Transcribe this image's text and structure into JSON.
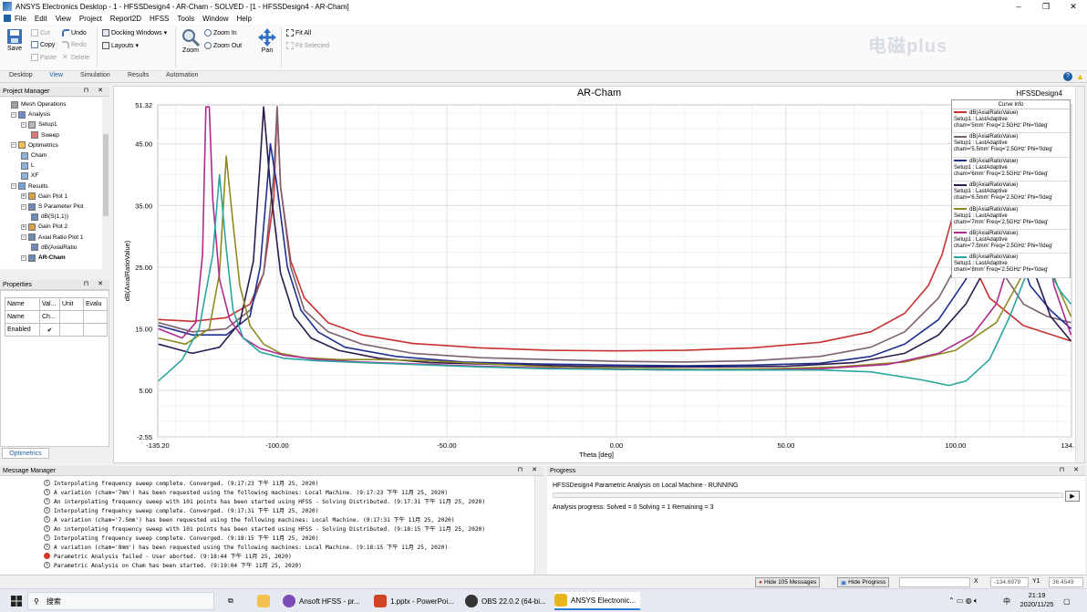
{
  "window": {
    "title": "ANSYS Electronics Desktop - 1 - HFSSDesign4 - AR-Cham - SOLVED - [1 - HFSSDesign4 - AR-Cham]",
    "controls": [
      "–",
      "❐",
      "✕"
    ]
  },
  "menu": [
    "File",
    "Edit",
    "View",
    "Project",
    "Report2D",
    "HFSS",
    "Tools",
    "Window",
    "Help"
  ],
  "ribbon": {
    "save": "Save",
    "cut": "Cut",
    "copy": "Copy",
    "paste": "Paste",
    "undo": "Undo",
    "redo": "Redo",
    "delete": "Delete",
    "docking_windows": "Docking Windows ▾",
    "layouts": "Layouts ▾",
    "zoom": "Zoom",
    "zoom_in": "Zoom In",
    "zoom_out": "Zoom Out",
    "pan": "Pan",
    "fit_all": "Fit All",
    "fit_selected": "Fit Selected",
    "watermark": "电磁plus",
    "tabs": [
      "Desktop",
      "View",
      "Simulation",
      "Results",
      "Automation"
    ],
    "active_tab": "View"
  },
  "project_manager": {
    "title": "Project Manager",
    "tree": [
      {
        "label": "Mesh Operations",
        "level": 2
      },
      {
        "label": "Analysis",
        "level": 2
      },
      {
        "label": "Setup1",
        "level": 3
      },
      {
        "label": "Sweep",
        "level": 4
      },
      {
        "label": "Optimetrics",
        "level": 2
      },
      {
        "label": "Cham",
        "level": 3
      },
      {
        "label": "L",
        "level": 3
      },
      {
        "label": "XF",
        "level": 3
      },
      {
        "label": "Results",
        "level": 2
      },
      {
        "label": "Gain Plot 1",
        "level": 3
      },
      {
        "label": "S Parameter Plot",
        "level": 3
      },
      {
        "label": "dB(S(1,1))",
        "level": 4
      },
      {
        "label": "Gain Plot 2",
        "level": 3
      },
      {
        "label": "Axial Ratio Plot 1",
        "level": 3
      },
      {
        "label": "dB(AxialRatio",
        "level": 4
      },
      {
        "label": "AR-Cham",
        "level": 3
      }
    ]
  },
  "properties": {
    "title": "Properties",
    "headers": [
      "Name",
      "Val...",
      "Unit",
      "Evalu"
    ],
    "rows": [
      [
        "Name",
        "Ch...",
        "",
        ""
      ],
      [
        "Enabled",
        "✔",
        "",
        ""
      ]
    ],
    "tab": "Optimetrics"
  },
  "plot": {
    "title": "AR-Cham",
    "design": "HFSSDesign4",
    "legend_title": "Curve Info",
    "legend": [
      {
        "l1": "dB(AxialRatioValue)",
        "l2": "Setup1 : LastAdaptive",
        "l3": "cham='5mm' Freq='2.5GHz' Phi='0deg'",
        "color": "#c8312f"
      },
      {
        "l1": "dB(AxialRatioValue)",
        "l2": "Setup1 : LastAdaptive",
        "l3": "cham='5.5mm' Freq='2.5GHz' Phi='0deg'",
        "color": "#7c6170"
      },
      {
        "l1": "dB(AxialRatioValue)",
        "l2": "Setup1 : LastAdaptive",
        "l3": "cham='6mm' Freq='2.5GHz' Phi='0deg'",
        "color": "#1f2f8f"
      },
      {
        "l1": "dB(AxialRatioValue)",
        "l2": "Setup1 : LastAdaptive",
        "l3": "cham='6.5mm' Freq='2.5GHz' Phi='0deg'",
        "color": "#2c1a4d"
      },
      {
        "l1": "dB(AxialRatioValue)",
        "l2": "Setup1 : LastAdaptive",
        "l3": "cham='7mm' Freq='2.5GHz' Phi='0deg'",
        "color": "#8e8a22"
      },
      {
        "l1": "dB(AxialRatioValue)",
        "l2": "Setup1 : LastAdaptive",
        "l3": "cham='7.5mm' Freq='2.5GHz' Phi='0deg'",
        "color": "#b02a8e"
      },
      {
        "l1": "dB(AxialRatioValue)",
        "l2": "Setup1 : LastAdaptive",
        "l3": "cham='8mm' Freq='2.5GHz' Phi='0deg'",
        "color": "#2aa6a0"
      }
    ]
  },
  "chart_data": {
    "type": "line",
    "title": "AR-Cham",
    "xlabel": "Theta [deg]",
    "ylabel": "dB(AxialRatioValue)",
    "xlim": [
      -135.2,
      134.17
    ],
    "ylim": [
      -2.55,
      51.32
    ],
    "xticks": [
      -135.2,
      -100.0,
      -50.0,
      0.0,
      50.0,
      100.0,
      134.17
    ],
    "xtick_labels": [
      "-135.20",
      "-100.00",
      "-50.00",
      "0.00",
      "50.00",
      "100.00",
      "134.17"
    ],
    "yticks": [
      -2.55,
      5.0,
      15.0,
      25.0,
      35.0,
      45.0,
      51.32
    ],
    "ytick_labels": [
      "-2.55",
      "5.00",
      "15.00",
      "25.00",
      "35.00",
      "45.00",
      "51.32"
    ],
    "grid": true,
    "legend_position": "top-right",
    "series": [
      {
        "name": "cham='5mm'",
        "color": "#c8312f",
        "x": [
          -135,
          -125,
          -115,
          -108,
          -104,
          -101,
          -100,
          -99,
          -96,
          -92,
          -85,
          -75,
          -60,
          -40,
          -20,
          0,
          20,
          40,
          60,
          75,
          85,
          92,
          96,
          99,
          101,
          104,
          110,
          120,
          134
        ],
        "y": [
          16.5,
          16.2,
          16.8,
          19,
          24,
          36,
          51,
          38,
          26,
          20,
          16,
          14,
          12.6,
          11.9,
          11.5,
          11.4,
          11.5,
          11.9,
          12.8,
          14.5,
          17.5,
          22,
          27,
          33,
          35,
          27,
          20,
          15.5,
          13
        ]
      },
      {
        "name": "cham='5.5mm'",
        "color": "#7c6170",
        "x": [
          -135,
          -125,
          -115,
          -108,
          -104,
          -101,
          -100,
          -99,
          -96,
          -92,
          -85,
          -75,
          -60,
          -40,
          -20,
          0,
          20,
          40,
          60,
          75,
          85,
          95,
          103,
          107,
          110,
          114,
          120,
          127,
          134
        ],
        "y": [
          16,
          14.5,
          15,
          18,
          24,
          40,
          51,
          38,
          25,
          18,
          14.5,
          12.5,
          11,
          10.3,
          10,
          9.7,
          9.6,
          9.8,
          10.5,
          12,
          14.5,
          20,
          28,
          34,
          32,
          24,
          19,
          17,
          16
        ]
      },
      {
        "name": "cham='6mm'",
        "color": "#1f2f8f",
        "x": [
          -135,
          -125,
          -115,
          -108,
          -105,
          -103,
          -102,
          -100,
          -97,
          -93,
          -88,
          -80,
          -65,
          -45,
          -25,
          0,
          20,
          40,
          60,
          75,
          85,
          95,
          103,
          108,
          113,
          117,
          122,
          128,
          134
        ],
        "y": [
          15.5,
          14,
          14,
          17,
          25,
          38,
          45,
          38,
          25,
          18,
          14.5,
          12,
          10.5,
          9.6,
          9.3,
          9.1,
          9,
          9.1,
          9.4,
          10.5,
          12.5,
          16.5,
          23,
          30,
          35,
          30,
          22,
          18,
          15
        ]
      },
      {
        "name": "cham='6.5mm'",
        "color": "#2c1a4d",
        "x": [
          -135,
          -125,
          -117,
          -111,
          -107,
          -105,
          -104,
          -102,
          -99,
          -95,
          -90,
          -82,
          -70,
          -55,
          -35,
          -10,
          10,
          30,
          50,
          70,
          85,
          95,
          103,
          108,
          113,
          117,
          121,
          124,
          128,
          134
        ],
        "y": [
          12.5,
          11,
          12,
          16,
          26,
          42,
          51,
          38,
          24,
          17,
          13.5,
          11.5,
          10.2,
          9.5,
          9.2,
          8.9,
          8.8,
          8.8,
          8.9,
          9.5,
          11,
          14,
          19,
          24,
          30,
          35,
          30,
          23,
          17,
          13
        ]
      },
      {
        "name": "cham='7mm'",
        "color": "#8e8a22",
        "x": [
          -135,
          -127,
          -120,
          -117,
          -115,
          -113,
          -111,
          -108,
          -104,
          -99,
          -92,
          -82,
          -70,
          -55,
          -35,
          -15,
          5,
          25,
          45,
          65,
          85,
          100,
          112,
          120,
          125,
          130,
          134
        ],
        "y": [
          13.5,
          12.5,
          15,
          24,
          43,
          32,
          22,
          15.5,
          12.5,
          11,
          10.3,
          10,
          10,
          9.8,
          9.2,
          8.7,
          8.5,
          8.4,
          8.5,
          8.8,
          9.6,
          11.5,
          16,
          24,
          30,
          22,
          17
        ]
      },
      {
        "name": "cham='7.5mm'",
        "color": "#b02a8e",
        "x": [
          -135,
          -128,
          -124,
          -122,
          -121,
          -120,
          -119,
          -117,
          -114,
          -110,
          -105,
          -98,
          -88,
          -75,
          -60,
          -40,
          -20,
          0,
          20,
          40,
          60,
          80,
          95,
          105,
          112,
          117,
          120,
          122,
          125,
          129,
          134
        ],
        "y": [
          15,
          13.5,
          16,
          27,
          51,
          51,
          36,
          23,
          16.5,
          13.5,
          11.8,
          10.7,
          10,
          9.6,
          9.3,
          8.9,
          8.6,
          8.4,
          8.3,
          8.3,
          8.5,
          9.2,
          11,
          14,
          19,
          28,
          40,
          51,
          36,
          22,
          14
        ]
      },
      {
        "name": "cham='8mm'",
        "color": "#2aa6a0",
        "x": [
          -135,
          -128,
          -123,
          -119,
          -117,
          -115,
          -113,
          -110,
          -105,
          -98,
          -88,
          -75,
          -60,
          -40,
          -20,
          0,
          20,
          40,
          60,
          75,
          90,
          98,
          103,
          110,
          116,
          121,
          125,
          128,
          131,
          134
        ],
        "y": [
          6.5,
          10,
          15,
          27,
          40,
          28,
          18,
          13.5,
          11.2,
          10.2,
          9.8,
          9.5,
          9.2,
          8.8,
          8.5,
          8.4,
          8.3,
          8.3,
          8.3,
          8,
          6.7,
          5.8,
          6.5,
          10,
          17,
          24,
          27,
          24,
          21,
          19
        ]
      }
    ]
  },
  "messages": {
    "title": "Message Manager",
    "items": [
      {
        "type": "info",
        "text": "Interpolating frequency sweep complete. Converged. (9:17:23 下午  11月 25, 2020)"
      },
      {
        "type": "info",
        "text": "A variation (cham='7mm') has been requested using the following machines: Local Machine. (9:17:23 下午  11月 25, 2020)"
      },
      {
        "type": "info",
        "text": "An interpolating frequency sweep with 101 points has been started using HFSS - Solving Distributed. (9:17:31 下午  11月 25, 2020)"
      },
      {
        "type": "info",
        "text": "Interpolating frequency sweep complete. Converged. (9:17:31 下午  11月 25, 2020)"
      },
      {
        "type": "info",
        "text": "A variation (cham='7.5mm') has been requested using the following machines: Local Machine. (9:17:31 下午  11月 25, 2020)"
      },
      {
        "type": "info",
        "text": "An interpolating frequency sweep with 101 points has been started using HFSS - Solving Distributed. (9:18:15 下午  11月 25, 2020)"
      },
      {
        "type": "info",
        "text": "Interpolating frequency sweep complete. Converged. (9:18:15 下午  11月 25, 2020)"
      },
      {
        "type": "info",
        "text": "A variation (cham='8mm') has been requested using the following machines: Local Machine. (9:18:15 下午  11月 25, 2020)"
      },
      {
        "type": "error",
        "text": "Parametric Analysis failed - User aborted. (9:18:44 下午  11月 25, 2020)"
      },
      {
        "type": "info",
        "text": "Parametric Analysis on Cham has been started. (9:19:04 下午  11月 25, 2020)"
      }
    ]
  },
  "progress": {
    "title": "Progress",
    "task": "HFSSDesign4 Parametric Analysis on Local Machine - RUNNING",
    "status": "Analysis progress:  Solved = 0   Solving = 1   Remaining = 3"
  },
  "statusbar": {
    "hide_messages": "Hide 105 Messages",
    "hide_progress": "Hide Progress",
    "x_label": "X",
    "x_value": "-134.6979",
    "y_label": "Y1",
    "y_value": "36.4549"
  },
  "taskbar": {
    "search": "搜索",
    "apps": [
      "Ansoft HFSS - pr...",
      "1.pptx - PowerPoi...",
      "OBS 22.0.2 (64-bi...",
      "ANSYS Electronic..."
    ],
    "time": "21:19",
    "date": "2020/11/25",
    "ime": "中"
  }
}
